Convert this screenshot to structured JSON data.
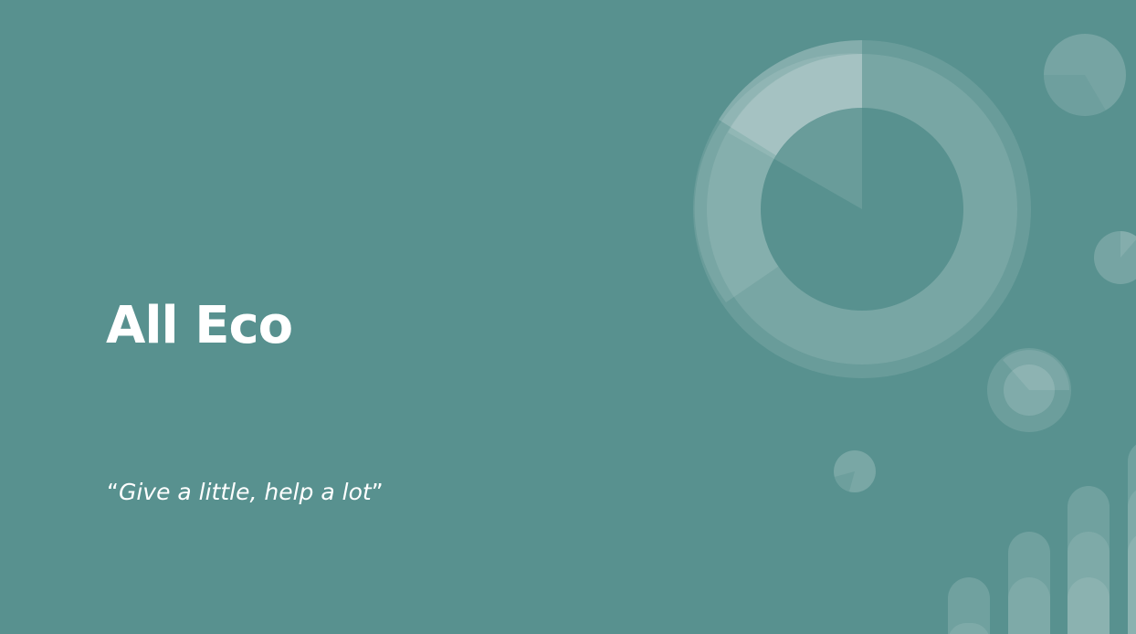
{
  "slide": {
    "title": "All Eco",
    "subtitle": {
      "open_quote": "“",
      "text": "Give a little, help a lot",
      "close_quote": "”"
    }
  },
  "colors": {
    "background": "#58918f",
    "text": "#ffffff",
    "decoration": "#ffffff"
  }
}
